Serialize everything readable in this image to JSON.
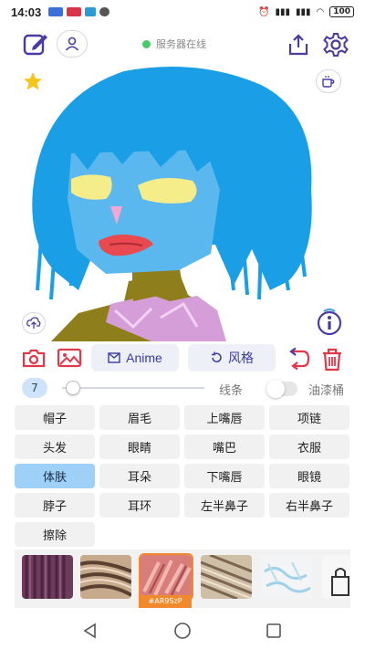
{
  "status_bar": {
    "time": "14:03",
    "battery": "100"
  },
  "header": {
    "server_status": "服务器在线",
    "icons": [
      "edit-icon",
      "user-icon",
      "share-icon",
      "settings-icon",
      "star-icon",
      "coffee-icon",
      "upload-icon",
      "info-icon"
    ]
  },
  "actions": {
    "anime_label": "Anime",
    "style_label": "风格"
  },
  "brush": {
    "size": "7",
    "size_fraction": 0.05,
    "stroke_label": "线条",
    "bucket_label": "油漆桶"
  },
  "parts": [
    {
      "label": "帽子",
      "active": false
    },
    {
      "label": "眉毛",
      "active": false
    },
    {
      "label": "上嘴唇",
      "active": false
    },
    {
      "label": "项链",
      "active": false
    },
    {
      "label": "头发",
      "active": false
    },
    {
      "label": "眼睛",
      "active": false
    },
    {
      "label": "嘴巴",
      "active": false
    },
    {
      "label": "衣服",
      "active": false
    },
    {
      "label": "体肤",
      "active": true
    },
    {
      "label": "耳朵",
      "active": false
    },
    {
      "label": "下嘴唇",
      "active": false
    },
    {
      "label": "眼镜",
      "active": false
    },
    {
      "label": "脖子",
      "active": false
    },
    {
      "label": "耳环",
      "active": false
    },
    {
      "label": "左半鼻子",
      "active": false
    },
    {
      "label": "右半鼻子",
      "active": false
    },
    {
      "label": "擦除",
      "active": false
    }
  ],
  "palette": {
    "selected_tag": "#AR9SzP",
    "accent": "#f08a2d",
    "active_part": "#9fd0f7",
    "icon_purple": "#4a3ba3",
    "icon_red": "#e0374b"
  }
}
